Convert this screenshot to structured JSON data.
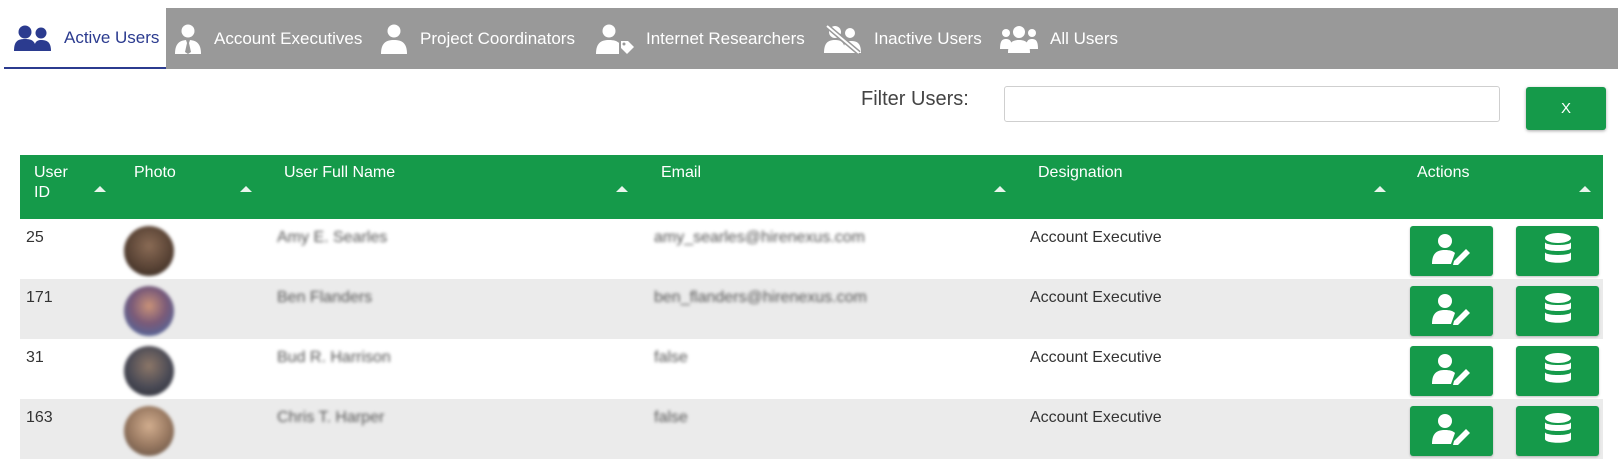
{
  "tabs": [
    {
      "label": "Active Users",
      "icon": "user-group-icon",
      "active": true
    },
    {
      "label": "Account Executives",
      "icon": "user-tie-icon",
      "active": false
    },
    {
      "label": "Project Coordinators",
      "icon": "user-icon",
      "active": false
    },
    {
      "label": "Internet Researchers",
      "icon": "user-tag-icon",
      "active": false
    },
    {
      "label": "Inactive Users",
      "icon": "user-slash-icon",
      "active": false
    },
    {
      "label": "All Users",
      "icon": "users-icon",
      "active": false
    }
  ],
  "filter": {
    "label": "Filter Users:",
    "value": "",
    "placeholder": "",
    "clear_label": "X"
  },
  "table": {
    "columns": [
      "User ID",
      "Photo",
      "User Full Name",
      "Email",
      "Designation",
      "Actions"
    ],
    "rows": [
      {
        "id": "25",
        "name": "Amy E. Searles",
        "email": "amy_searles@hirenexus.com",
        "designation": "Account Executive"
      },
      {
        "id": "171",
        "name": "Ben Flanders",
        "email": "ben_flanders@hirenexus.com",
        "designation": "Account Executive"
      },
      {
        "id": "31",
        "name": "Bud R. Harrison",
        "email": "false",
        "designation": "Account Executive"
      },
      {
        "id": "163",
        "name": "Chris T. Harper",
        "email": "false",
        "designation": "Account Executive"
      }
    ]
  },
  "colors": {
    "accent_green": "#159a4a",
    "tab_bar": "#999999",
    "active_tab_text": "#2b3b8f",
    "row_alt": "#ebebeb"
  }
}
